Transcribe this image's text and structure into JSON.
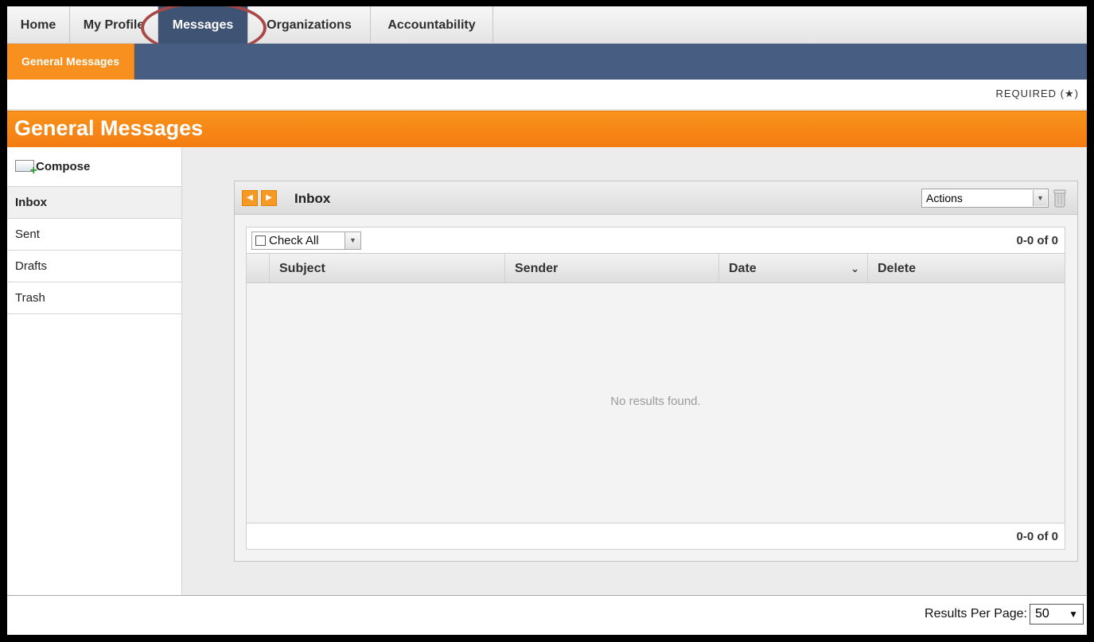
{
  "nav": {
    "tabs": [
      {
        "label": "Home"
      },
      {
        "label": "My Profile"
      },
      {
        "label": "Messages",
        "active": true
      },
      {
        "label": "Organizations"
      },
      {
        "label": "Accountability"
      }
    ]
  },
  "subnav": {
    "active_tab": "General Messages"
  },
  "required_note": "REQUIRED (★)",
  "page_title": "General Messages",
  "sidebar": {
    "compose_label": "Compose",
    "items": [
      {
        "label": "Inbox",
        "active": true
      },
      {
        "label": "Sent"
      },
      {
        "label": "Drafts"
      },
      {
        "label": "Trash"
      }
    ]
  },
  "inbox": {
    "title": "Inbox",
    "prev_icon": "arrow-left-icon",
    "next_icon": "arrow-right-icon",
    "actions_label": "Actions",
    "trash_icon": "trash-can-icon",
    "check_all_label": "Check All",
    "count_top": "0-0 of 0",
    "count_bottom": "0-0 of 0",
    "columns": [
      "Subject",
      "Sender",
      "Date",
      "Delete"
    ],
    "empty_message": "No results found."
  },
  "footer": {
    "results_per_page_label": "Results Per Page:",
    "results_per_page_value": "50"
  },
  "colors": {
    "accent_orange": "#f7901e",
    "nav_blue": "#475d82",
    "highlight_ring": "#a94848"
  }
}
